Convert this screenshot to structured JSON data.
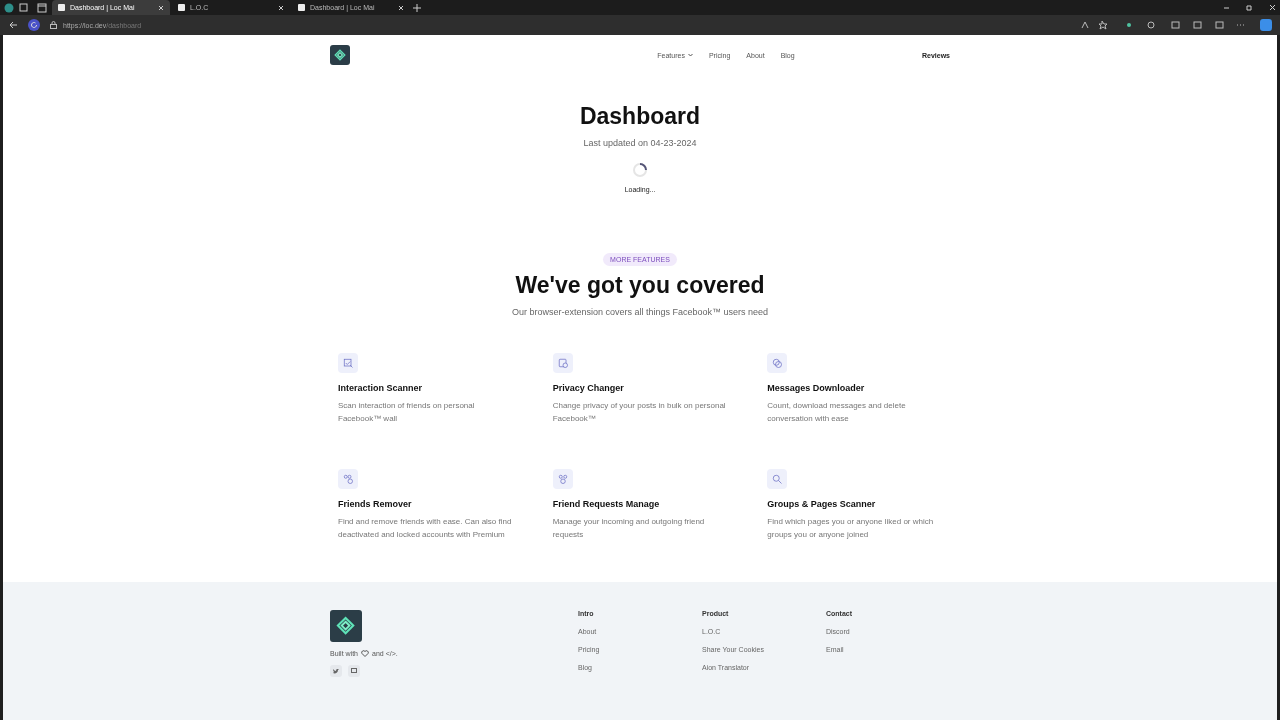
{
  "browser": {
    "tabs": [
      {
        "title": "Dashboard | Loc Mai",
        "selected": true
      },
      {
        "title": "L.O.C",
        "selected": false
      },
      {
        "title": "Dashboard | Loc Mai",
        "selected": false
      }
    ],
    "url": {
      "host": "https://loc.dev",
      "path": "/dashboard"
    }
  },
  "nav": {
    "items": [
      {
        "label": "Features",
        "dropdown": true
      },
      {
        "label": "Pricing",
        "dropdown": false
      },
      {
        "label": "About",
        "dropdown": false
      },
      {
        "label": "Blog",
        "dropdown": false
      }
    ],
    "right": "Reviews"
  },
  "hero": {
    "title": "Dashboard",
    "subtitle": "Last updated on 04-23-2024",
    "loading": "Loading..."
  },
  "features": {
    "badge": "MORE FEATURES",
    "title": "We've got you covered",
    "subtitle": "Our browser-extension covers all things Facebook™ users need",
    "items": [
      {
        "kind": "scan",
        "title": "Interaction Scanner",
        "text": "Scan interaction of friends on personal Facebook™ wall"
      },
      {
        "kind": "privacy",
        "title": "Privacy Changer",
        "text": "Change privacy of your posts in bulk on personal Facebook™"
      },
      {
        "kind": "messages",
        "title": "Messages Downloader",
        "text": "Count, download messages and delete conversation with ease"
      },
      {
        "kind": "friends",
        "title": "Friends Remover",
        "text": "Find and remove friends with ease. Can also find deactivated and locked accounts with Premium"
      },
      {
        "kind": "requests",
        "title": "Friend Requests Manage",
        "text": "Manage your incoming and outgoing friend requests"
      },
      {
        "kind": "search",
        "title": "Groups & Pages Scanner",
        "text": "Find which pages you or anyone liked or which groups you or anyone joined"
      }
    ]
  },
  "footer": {
    "built_with": [
      "Built with",
      "and </>."
    ],
    "columns": [
      {
        "title": "Intro",
        "links": [
          "About",
          "Pricing",
          "Blog"
        ]
      },
      {
        "title": "Product",
        "links": [
          "L.O.C",
          "Share Your Cookies",
          "Aion Translator"
        ]
      },
      {
        "title": "Contact",
        "links": [
          "Discord",
          "Email"
        ]
      }
    ]
  }
}
